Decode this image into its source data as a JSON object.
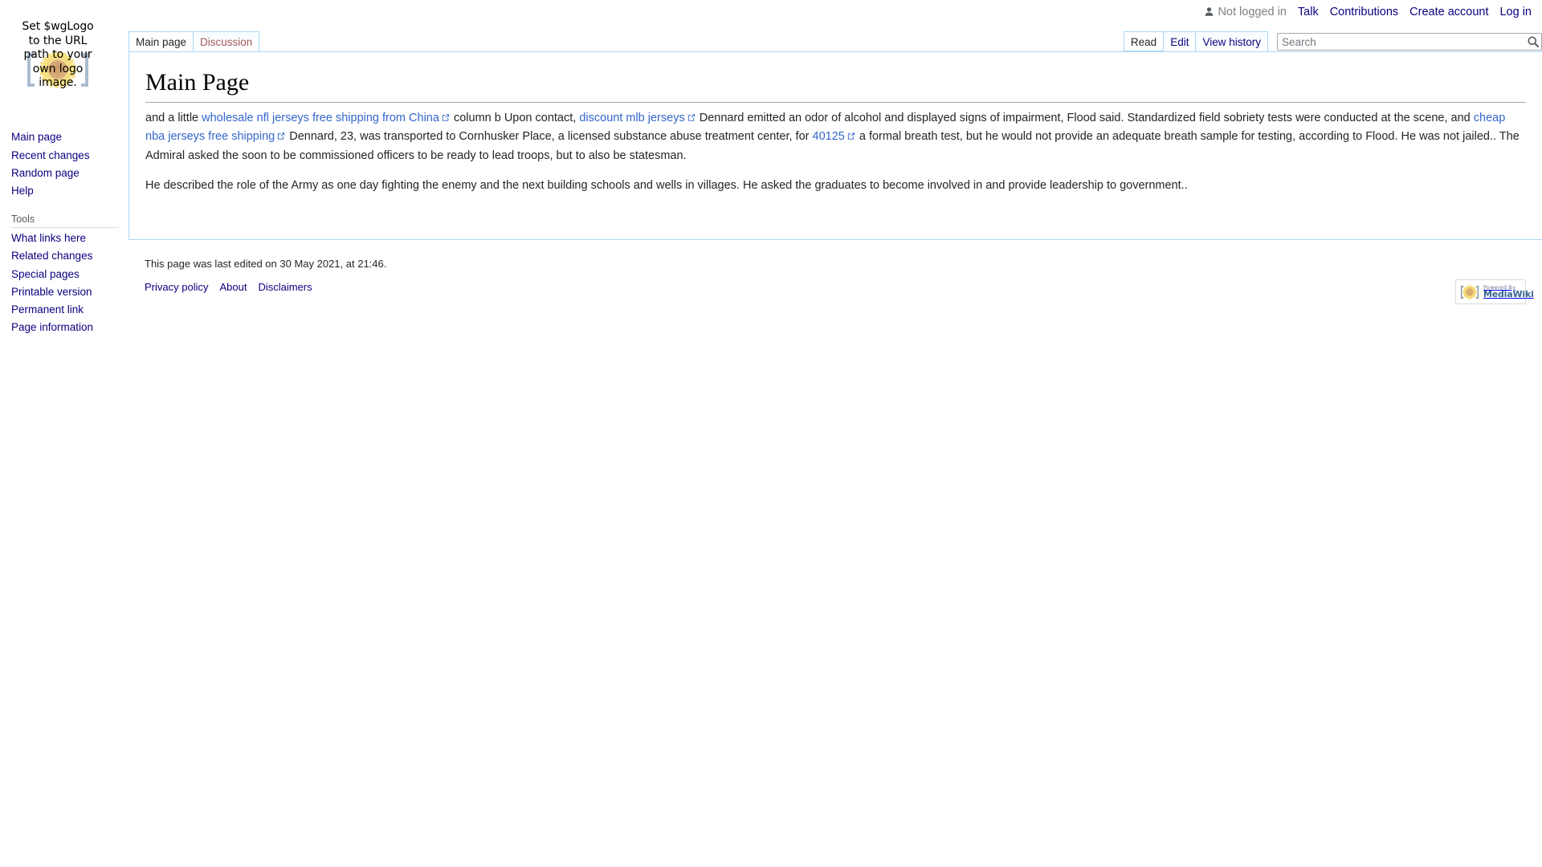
{
  "personal_tools": {
    "anon_icon": "user-anon-icon",
    "items": [
      {
        "label": "Not logged in",
        "type": "text"
      },
      {
        "label": "Talk",
        "type": "link"
      },
      {
        "label": "Contributions",
        "type": "link"
      },
      {
        "label": "Create account",
        "type": "link"
      },
      {
        "label": "Log in",
        "type": "link"
      }
    ]
  },
  "logo": {
    "caption": "Set $wgLogo to the URL path to your own logo image.",
    "icon": "mediawiki-sunflower-logo"
  },
  "namespace_tabs": [
    {
      "label": "Main page",
      "state": "selected"
    },
    {
      "label": "Discussion",
      "state": "new"
    }
  ],
  "view_tabs": [
    {
      "label": "Read",
      "state": "selected"
    },
    {
      "label": "Edit",
      "state": "normal"
    },
    {
      "label": "View history",
      "state": "normal"
    }
  ],
  "search": {
    "placeholder": "Search",
    "value": "",
    "icon": "search-icon"
  },
  "sidebar": {
    "portals": [
      {
        "id": "navigation",
        "heading": "",
        "items": [
          {
            "label": "Main page"
          },
          {
            "label": "Recent changes"
          },
          {
            "label": "Random page"
          },
          {
            "label": "Help"
          }
        ]
      },
      {
        "id": "tools",
        "heading": "Tools",
        "items": [
          {
            "label": "What links here"
          },
          {
            "label": "Related changes"
          },
          {
            "label": "Special pages"
          },
          {
            "label": "Printable version"
          },
          {
            "label": "Permanent link"
          },
          {
            "label": "Page information"
          }
        ]
      }
    ]
  },
  "page": {
    "title": "Main Page",
    "paragraph1": {
      "t1": "and a little ",
      "link1": "wholesale nfl jerseys free shipping from China",
      "t2": " column b Upon contact, ",
      "link2": "discount mlb jerseys",
      "t3": " Dennard emitted an odor of alcohol and displayed signs of impairment, Flood said. Standardized field sobriety tests were conducted at the scene, and ",
      "link3": "cheap nba jerseys free shipping",
      "t4": " Dennard, 23, was transported to Cornhusker Place, a licensed substance abuse treatment center, for ",
      "link4": "40125",
      "t5": " a formal breath test, but he would not provide an adequate breath sample for testing, according to Flood. He was not jailed.. The Admiral asked the soon to be commissioned officers to be ready to lead troops, but to also be statesman."
    },
    "paragraph2": "He described the role of the Army as one day fighting the enemy and the next building schools and wells in villages. He asked the graduates to become involved in and provide leadership to government.."
  },
  "footer": {
    "last_edited": "This page was last edited on 30 May 2021, at 21:46.",
    "places": [
      {
        "label": "Privacy policy"
      },
      {
        "label": "About"
      },
      {
        "label": "Disclaimers"
      }
    ],
    "badge": {
      "powered_by": "Powered By",
      "name": "MediaWiki",
      "icon": "mediawiki-badge-icon"
    }
  }
}
